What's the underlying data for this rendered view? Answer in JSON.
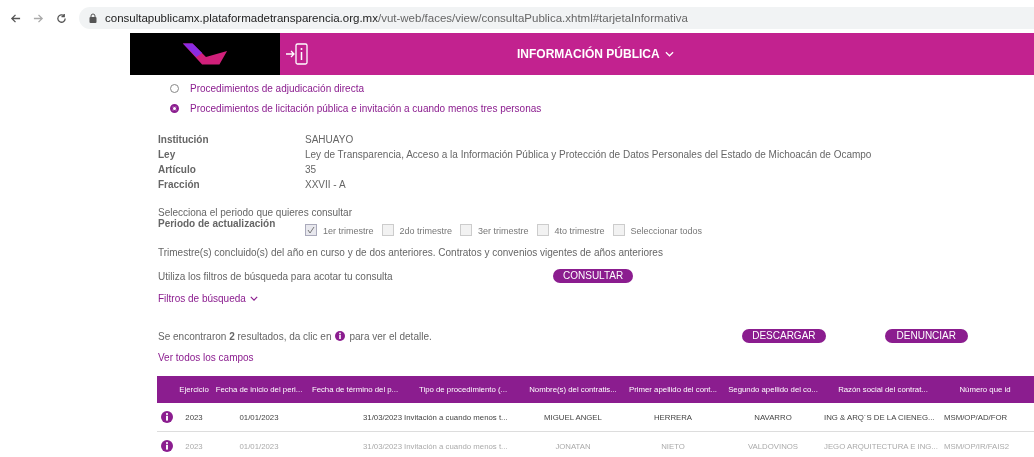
{
  "browser": {
    "url_host": "consultapublicamx.plataformadetransparencia.org.mx",
    "url_path": "/vut-web/faces/view/consultaPublica.xhtml#tarjetaInformativa"
  },
  "header": {
    "title": "INFORMACIÓN PÚBLICA"
  },
  "procedures": [
    {
      "label": "Procedimientos de adjudicación directa",
      "selected": false
    },
    {
      "label": "Procedimientos de licitación pública e invitación a cuando menos tres personas",
      "selected": true
    }
  ],
  "info": [
    {
      "label": "Institución",
      "value": "SAHUAYO"
    },
    {
      "label": "Ley",
      "value": "Ley de Transparencia, Acceso a la Información Pública y Protección de Datos Personales del Estado de Michoacán de Ocampo"
    },
    {
      "label": "Artículo",
      "value": "35"
    },
    {
      "label": "Fracción",
      "value": "XXVII - A"
    }
  ],
  "period": {
    "prompt": "Selecciona el periodo que quieres consultar",
    "label": "Periodo de actualización",
    "options": [
      {
        "label": "1er trimestre",
        "checked": true
      },
      {
        "label": "2do trimestre",
        "checked": false
      },
      {
        "label": "3er trimestre",
        "checked": false
      },
      {
        "label": "4to trimestre",
        "checked": false
      },
      {
        "label": "Seleccionar todos",
        "checked": false
      }
    ],
    "note": "Trimestre(s) concluido(s) del año en curso y de dos anteriores. Contratos y convenios vigentes de años anteriores"
  },
  "filter_hint": "Utiliza los filtros de búsqueda para acotar tu consulta",
  "consult_button": "CONSULTAR",
  "filters_link": "Filtros de búsqueda",
  "results": {
    "before": "Se encontraron **2** resultados, da clic en",
    "after": "para ver el detalle."
  },
  "download_button": "DESCARGAR",
  "report_button": "DENUNCIAR",
  "all_fields_link": "Ver todos los campos",
  "table": {
    "columns": [
      "Ejercicio",
      "Fecha de inicio del peri...",
      "Fecha de término del p...",
      "Tipo de procedimiento (...",
      "Nombre(s) del contratis...",
      "Primer apellido del cont...",
      "Segundo apellido del co...",
      "Razón social del contrat...",
      "Número que id"
    ],
    "rows": [
      {
        "dimmed": false,
        "cells": [
          "2023",
          "01/01/2023",
          "31/03/2023",
          "Invitación a cuando menos t...",
          "MIGUEL ANGEL",
          "HERRERA",
          "NAVARRO",
          "ING & ARQ´S DE LA CIENEG...",
          "MSM/OP/AD/FOR"
        ]
      },
      {
        "dimmed": true,
        "cells": [
          "2023",
          "01/01/2023",
          "31/03/2023",
          "Invitación a cuando menos t...",
          "JONATAN",
          "NIETO",
          "VALDOVINOS",
          "JEGO ARQUITECTURA E ING...",
          "MSM/OP/IR/FAIS2"
        ]
      }
    ]
  }
}
